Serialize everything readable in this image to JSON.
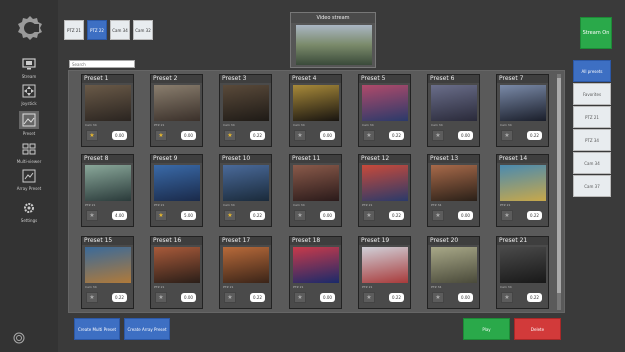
{
  "colors": {
    "accent_blue": "#3d6fc3",
    "stream_green": "#2aa94a",
    "delete_red": "#d23a3a",
    "favorite_gold": "#e5b62e"
  },
  "sidebar": {
    "items": [
      {
        "label": "Stream",
        "icon": "monitor-icon"
      },
      {
        "label": "Joystick",
        "icon": "joystick-icon"
      },
      {
        "label": "Preset",
        "icon": "preset-icon"
      },
      {
        "label": "Multi-viewer",
        "icon": "multiviewer-icon"
      },
      {
        "label": "Array Preset",
        "icon": "array-preset-icon"
      },
      {
        "label": "Settings",
        "icon": "gear-icon"
      }
    ]
  },
  "camera_tabs": [
    "PTZ 21",
    "PTZ 22",
    "Cam 34",
    "Cam 32"
  ],
  "video_stream": {
    "title": "Video stream"
  },
  "stream_button": {
    "label": "Stream On"
  },
  "search": {
    "placeholder": "Search"
  },
  "filters": [
    "All presets",
    "Favorites",
    "PTZ 21",
    "PTZ 34",
    "Cam 34",
    "Cam 37"
  ],
  "presets": [
    {
      "name": "Preset 1",
      "cam": "Cam 34",
      "speed": "0.00",
      "fav": true,
      "c1": "#6a5a48",
      "c2": "#2a2420"
    },
    {
      "name": "Preset 2",
      "cam": "PTZ 21",
      "speed": "0.00",
      "fav": true,
      "c1": "#8a7e6e",
      "c2": "#3a302a"
    },
    {
      "name": "Preset 3",
      "cam": "Cam 34",
      "speed": "0.22",
      "fav": true,
      "c1": "#5a4a3a",
      "c2": "#1e1a16"
    },
    {
      "name": "Preset 4",
      "cam": "Cam 34",
      "speed": "0.00",
      "fav": false,
      "c1": "#a88a3a",
      "c2": "#181410"
    },
    {
      "name": "Preset 5",
      "cam": "Cam 34",
      "speed": "0.22",
      "fav": false,
      "c1": "#b04a6a",
      "c2": "#2a3a6a"
    },
    {
      "name": "Preset 6",
      "cam": "Cam 34",
      "speed": "0.00",
      "fav": false,
      "c1": "#6a6e8a",
      "c2": "#2a2a3a"
    },
    {
      "name": "Preset 7",
      "cam": "Cam 34",
      "speed": "0.22",
      "fav": false,
      "c1": "#7a8aa8",
      "c2": "#1a1e2a"
    },
    {
      "name": "Preset 8",
      "cam": "PTZ 21",
      "speed": "4.00",
      "fav": false,
      "c1": "#8aa89a",
      "c2": "#2a3a3a"
    },
    {
      "name": "Preset 9",
      "cam": "PTZ 21",
      "speed": "5.00",
      "fav": true,
      "c1": "#3a6aa8",
      "c2": "#1a2a4a"
    },
    {
      "name": "Preset 10",
      "cam": "Cam 34",
      "speed": "0.22",
      "fav": true,
      "c1": "#4a6a9a",
      "c2": "#1a2a3a"
    },
    {
      "name": "Preset 11",
      "cam": "Cam 34",
      "speed": "0.00",
      "fav": false,
      "c1": "#8a5a4a",
      "c2": "#2a1a1a"
    },
    {
      "name": "Preset 12",
      "cam": "PTZ 21",
      "speed": "0.22",
      "fav": false,
      "c1": "#c84a3a",
      "c2": "#2a3a6a"
    },
    {
      "name": "Preset 13",
      "cam": "PTZ 34",
      "speed": "0.00",
      "fav": false,
      "c1": "#a86a4a",
      "c2": "#2a2018"
    },
    {
      "name": "Preset 14",
      "cam": "PTZ 21",
      "speed": "0.22",
      "fav": false,
      "c1": "#4a8ab0",
      "c2": "#c8a84a"
    },
    {
      "name": "Preset 15",
      "cam": "Cam 34",
      "speed": "0.22",
      "fav": false,
      "c1": "#3a6a9a",
      "c2": "#b07a3a"
    },
    {
      "name": "Preset 16",
      "cam": "PTZ 21",
      "speed": "0.00",
      "fav": false,
      "c1": "#a85a3a",
      "c2": "#2a1e18"
    },
    {
      "name": "Preset 17",
      "cam": "PTZ 21",
      "speed": "0.22",
      "fav": false,
      "c1": "#b86a3a",
      "c2": "#3a2418"
    },
    {
      "name": "Preset 18",
      "cam": "PTZ 21",
      "speed": "0.00",
      "fav": false,
      "c1": "#c83a4a",
      "c2": "#1a2a6a"
    },
    {
      "name": "Preset 19",
      "cam": "PTZ 21",
      "speed": "0.22",
      "fav": false,
      "c1": "#d0d0d8",
      "c2": "#a83a3a"
    },
    {
      "name": "Preset 20",
      "cam": "PTZ 34",
      "speed": "0.00",
      "fav": false,
      "c1": "#a8a888",
      "c2": "#4a4a3a"
    },
    {
      "name": "Preset 21",
      "cam": "Cam 34",
      "speed": "0.22",
      "fav": false,
      "c1": "#4a4a4a",
      "c2": "#181818"
    }
  ],
  "buttons": {
    "create_multi": "Create Multi Preset",
    "create_array": "Create Array Preset",
    "play": "Play",
    "delete": "Delete"
  }
}
